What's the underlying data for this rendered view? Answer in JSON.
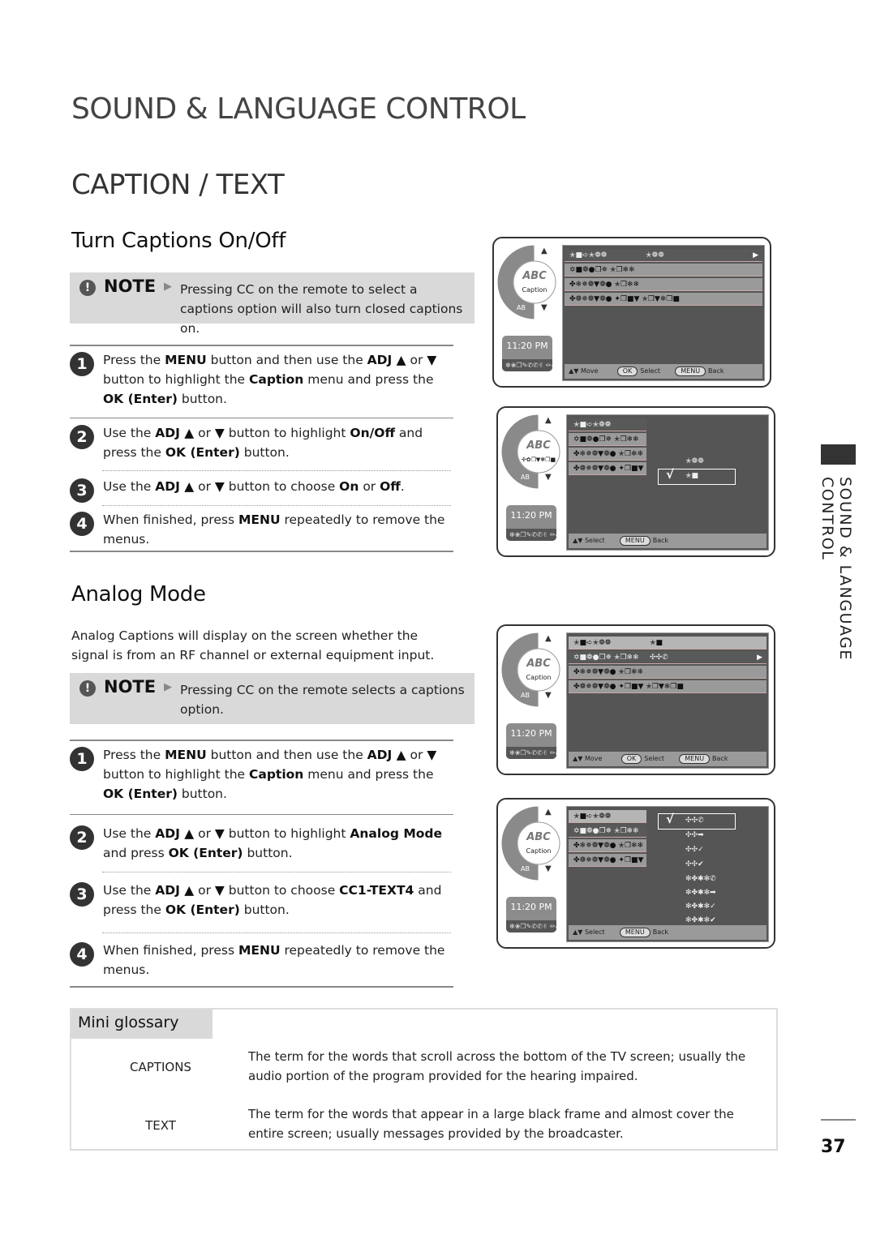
{
  "header": {
    "chapter_title": "SOUND & LANGUAGE CONTROL",
    "section_title": "CAPTION / TEXT"
  },
  "turn_captions": {
    "heading": "Turn Captions On/Off",
    "note": {
      "label": "NOTE",
      "text": "Pressing CC on the remote to select a captions option will also turn closed captions on."
    },
    "steps": [
      {
        "num": "1",
        "html": "Press the <b>MENU</b> button and then use the <b>ADJ ▲</b> or <b>▼</b> button to highlight the <b>Caption</b> menu and press the <b>OK (Enter)</b> button."
      },
      {
        "num": "2",
        "html": "Use the <b>ADJ ▲</b> or <b>▼</b> button to highlight <b>On/Off</b> and press the <b>OK (Enter)</b> button."
      },
      {
        "num": "3",
        "html": "Use the <b>ADJ ▲</b> or <b>▼</b> button to choose <b>On</b> or <b>Off</b>."
      },
      {
        "num": "4",
        "html": "When finished, press <b>MENU</b> repeatedly to remove the menus."
      }
    ]
  },
  "analog_mode": {
    "heading": "Analog Mode",
    "intro": "Analog Captions will display on the screen whether the signal is from an RF channel or external equipment input.",
    "note": {
      "label": "NOTE",
      "text": "Pressing CC on the remote selects a captions option."
    },
    "steps": [
      {
        "num": "1",
        "html": "Press the <b>MENU</b> button and then use the <b>ADJ ▲</b> or <b>▼</b> button to highlight the <b>Caption</b> menu and press the <b>OK (Enter)</b> button."
      },
      {
        "num": "2",
        "html": "Use the <b>ADJ ▲</b> or <b>▼</b> button to highlight <b>Analog Mode</b> and press <b>OK (Enter)</b> button."
      },
      {
        "num": "3",
        "html": "Use the <b>ADJ ▲</b> or <b>▼</b> button to choose <b>CC1-TEXT4</b> and press the <b>OK (Enter)</b> button."
      },
      {
        "num": "4",
        "html": "When finished, press <b>MENU</b> repeatedly to remove the menus."
      }
    ]
  },
  "tv_menu": {
    "wheel_label": "Caption",
    "wheel_label_garbled": "✣✿❒▼❃❒■",
    "clock": "11:20 PM",
    "clock_sub": "✻❀❒✎✆✆✌ ✏✍✖",
    "rows": [
      "✭■➪✭❁❁",
      "✡■❁●❒✵ ✭❒❄❄",
      "✤❄✵❁▼❁● ✭❒❄❄",
      "✤❁✵❁▼❁● ✦❒■▼ ✭❒▼❄❒■"
    ],
    "row0_value_off": "✭❁❁",
    "row0_value_on": "✭■",
    "row1_value": "✣✣✆",
    "popup_onoff": [
      "✭❁❁",
      "✭■"
    ],
    "analog_options": [
      "✣✣✆",
      "✣✣➡",
      "✣✣✓",
      "✣✣✔",
      "✻✤✱✻✆",
      "✻✤✱✻➡",
      "✻✤✱✻✓",
      "✻✤✱✻✔"
    ],
    "footer_move": "Move",
    "footer_select": "Select",
    "footer_back": "Back",
    "key_ok": "OK",
    "key_menu": "MENU",
    "arrows": "▲▼",
    "check": "√",
    "submenu_arrow": "▶"
  },
  "sidebar": {
    "vertical_title": "SOUND & LANGUAGE CONTROL",
    "page_number": "37"
  },
  "glossary": {
    "heading": "Mini glossary",
    "entries": [
      {
        "term": "CAPTIONS",
        "definition": "The term for the words that scroll across the bottom of the TV screen; usually the audio portion of the program provided for the hearing impaired."
      },
      {
        "term": "TEXT",
        "definition": "The term for the words that appear in a large black frame and almost cover the entire screen; usually messages provided by the broadcaster."
      }
    ]
  }
}
